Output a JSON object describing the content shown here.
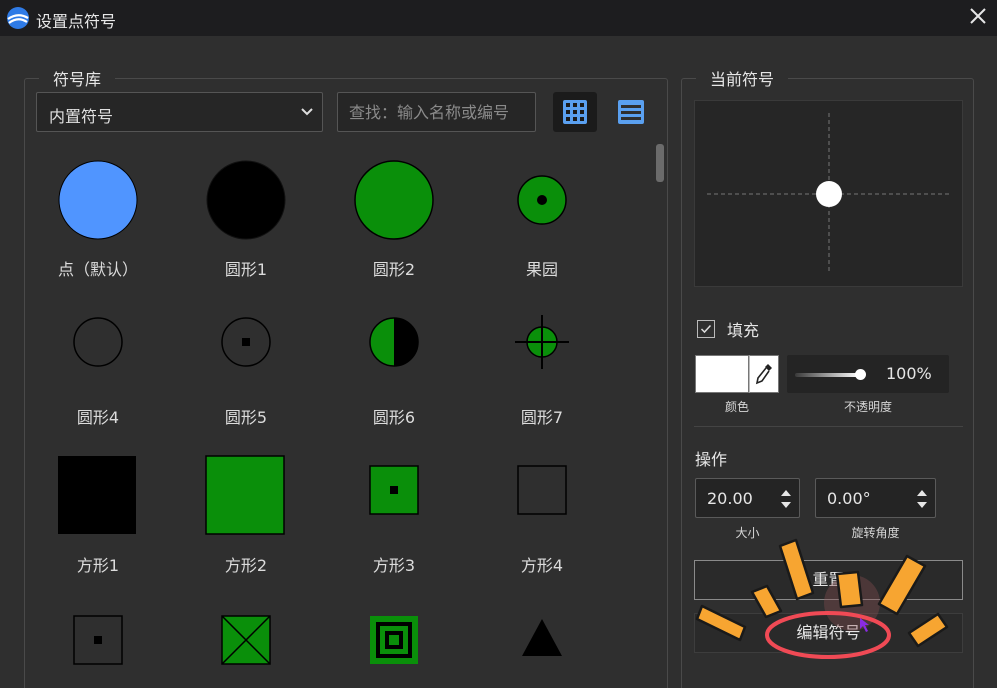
{
  "window": {
    "title": "设置点符号"
  },
  "library": {
    "legend": "符号库",
    "category_selected": "内置符号",
    "search_placeholder": "查找：输入名称或编号",
    "view_mode": "grid",
    "symbols": [
      {
        "label": "点（默认）",
        "icon": "circle-blue-filled"
      },
      {
        "label": "圆形1",
        "icon": "circle-black-filled"
      },
      {
        "label": "圆形2",
        "icon": "circle-green-filled"
      },
      {
        "label": "果园",
        "icon": "circle-green-dot"
      },
      {
        "label": "圆形4",
        "icon": "circle-outline"
      },
      {
        "label": "圆形5",
        "icon": "circle-outline-dot"
      },
      {
        "label": "圆形6",
        "icon": "circle-half-green-black"
      },
      {
        "label": "圆形7",
        "icon": "circle-crosshair-green"
      },
      {
        "label": "方形1",
        "icon": "square-black-filled"
      },
      {
        "label": "方形2",
        "icon": "square-green-filled"
      },
      {
        "label": "方形3",
        "icon": "square-green-dot"
      },
      {
        "label": "方形4",
        "icon": "square-outline"
      },
      {
        "label": "",
        "icon": "square-outline-dot"
      },
      {
        "label": "",
        "icon": "square-green-x"
      },
      {
        "label": "",
        "icon": "square-green-concentric"
      },
      {
        "label": "",
        "icon": "triangle-black"
      }
    ]
  },
  "current": {
    "legend": "当前符号",
    "fill_label": "填充",
    "fill_checked": true,
    "color_value": "#ffffff",
    "color_label": "颜色",
    "opacity_value": "100%",
    "opacity_fraction": 1.0,
    "opacity_label": "不透明度",
    "ops_label": "操作",
    "size_value": "20.00",
    "size_label": "大小",
    "rotation_value": "0.00°",
    "rotation_label": "旋转角度",
    "reset_label": "重置",
    "edit_label": "编辑符号"
  },
  "colors": {
    "accent_blue": "#5095ff",
    "symbol_green": "#0a8f0a",
    "highlight_orange": "#f7a531",
    "annotation_red": "#f04a55"
  }
}
